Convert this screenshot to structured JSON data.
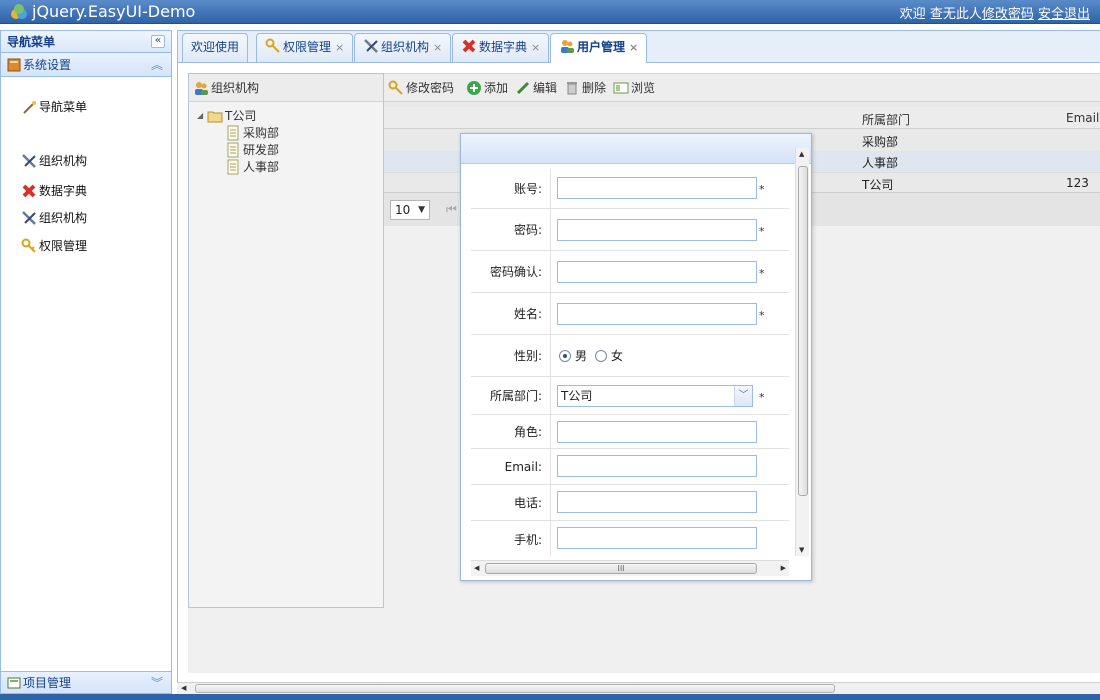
{
  "app": {
    "title": "jQuery.EasyUI-Demo",
    "welcome": "欢迎",
    "username": "查无此人",
    "change_password": "修改密码",
    "logout": "安全退出"
  },
  "leftnav": {
    "header": "导航菜单",
    "collapse_icon": "«",
    "section_title": "系统设置",
    "items": [
      {
        "label": "导航菜单",
        "icon": "wand-icon"
      },
      {
        "label": "组织机构",
        "icon": "tools-icon"
      },
      {
        "label": "数据字典",
        "icon": "red-x-icon"
      },
      {
        "label": "组织机构",
        "icon": "tools-icon"
      },
      {
        "label": "权限管理",
        "icon": "key-icon"
      }
    ],
    "bottom_section": "项目管理"
  },
  "tabs": [
    {
      "label": "欢迎使用",
      "closable": false
    },
    {
      "label": "权限管理",
      "closable": true,
      "icon": "key-icon"
    },
    {
      "label": "组织机构",
      "closable": true,
      "icon": "tools-icon"
    },
    {
      "label": "数据字典",
      "closable": true,
      "icon": "red-x-icon"
    },
    {
      "label": "用户管理",
      "closable": true,
      "icon": "users-icon",
      "active": true
    }
  ],
  "tab_close_glyph": "×",
  "org": {
    "header": "组织机构",
    "root": "T公司",
    "children": [
      "采购部",
      "研发部",
      "人事部"
    ]
  },
  "toolbar": {
    "change_password": "修改密码",
    "add": "添加",
    "edit": "编辑",
    "delete": "删除",
    "browse": "浏览"
  },
  "grid": {
    "columns": [
      "所属部门",
      "Email"
    ],
    "rows": [
      {
        "dept": "采购部",
        "email": ""
      },
      {
        "dept": "人事部",
        "email": ""
      },
      {
        "dept": "T公司",
        "email": "123"
      }
    ],
    "page_size": "10"
  },
  "form": {
    "account_label": "账号:",
    "password_label": "密码:",
    "confirm_label": "密码确认:",
    "name_label": "姓名:",
    "gender_label": "性别:",
    "gender_male": "男",
    "gender_female": "女",
    "dept_label": "所属部门:",
    "dept_value": "T公司",
    "role_label": "角色:",
    "email_label": "Email:",
    "phone_label": "电话:",
    "mobile_label": "手机:",
    "required_mark": "*"
  }
}
